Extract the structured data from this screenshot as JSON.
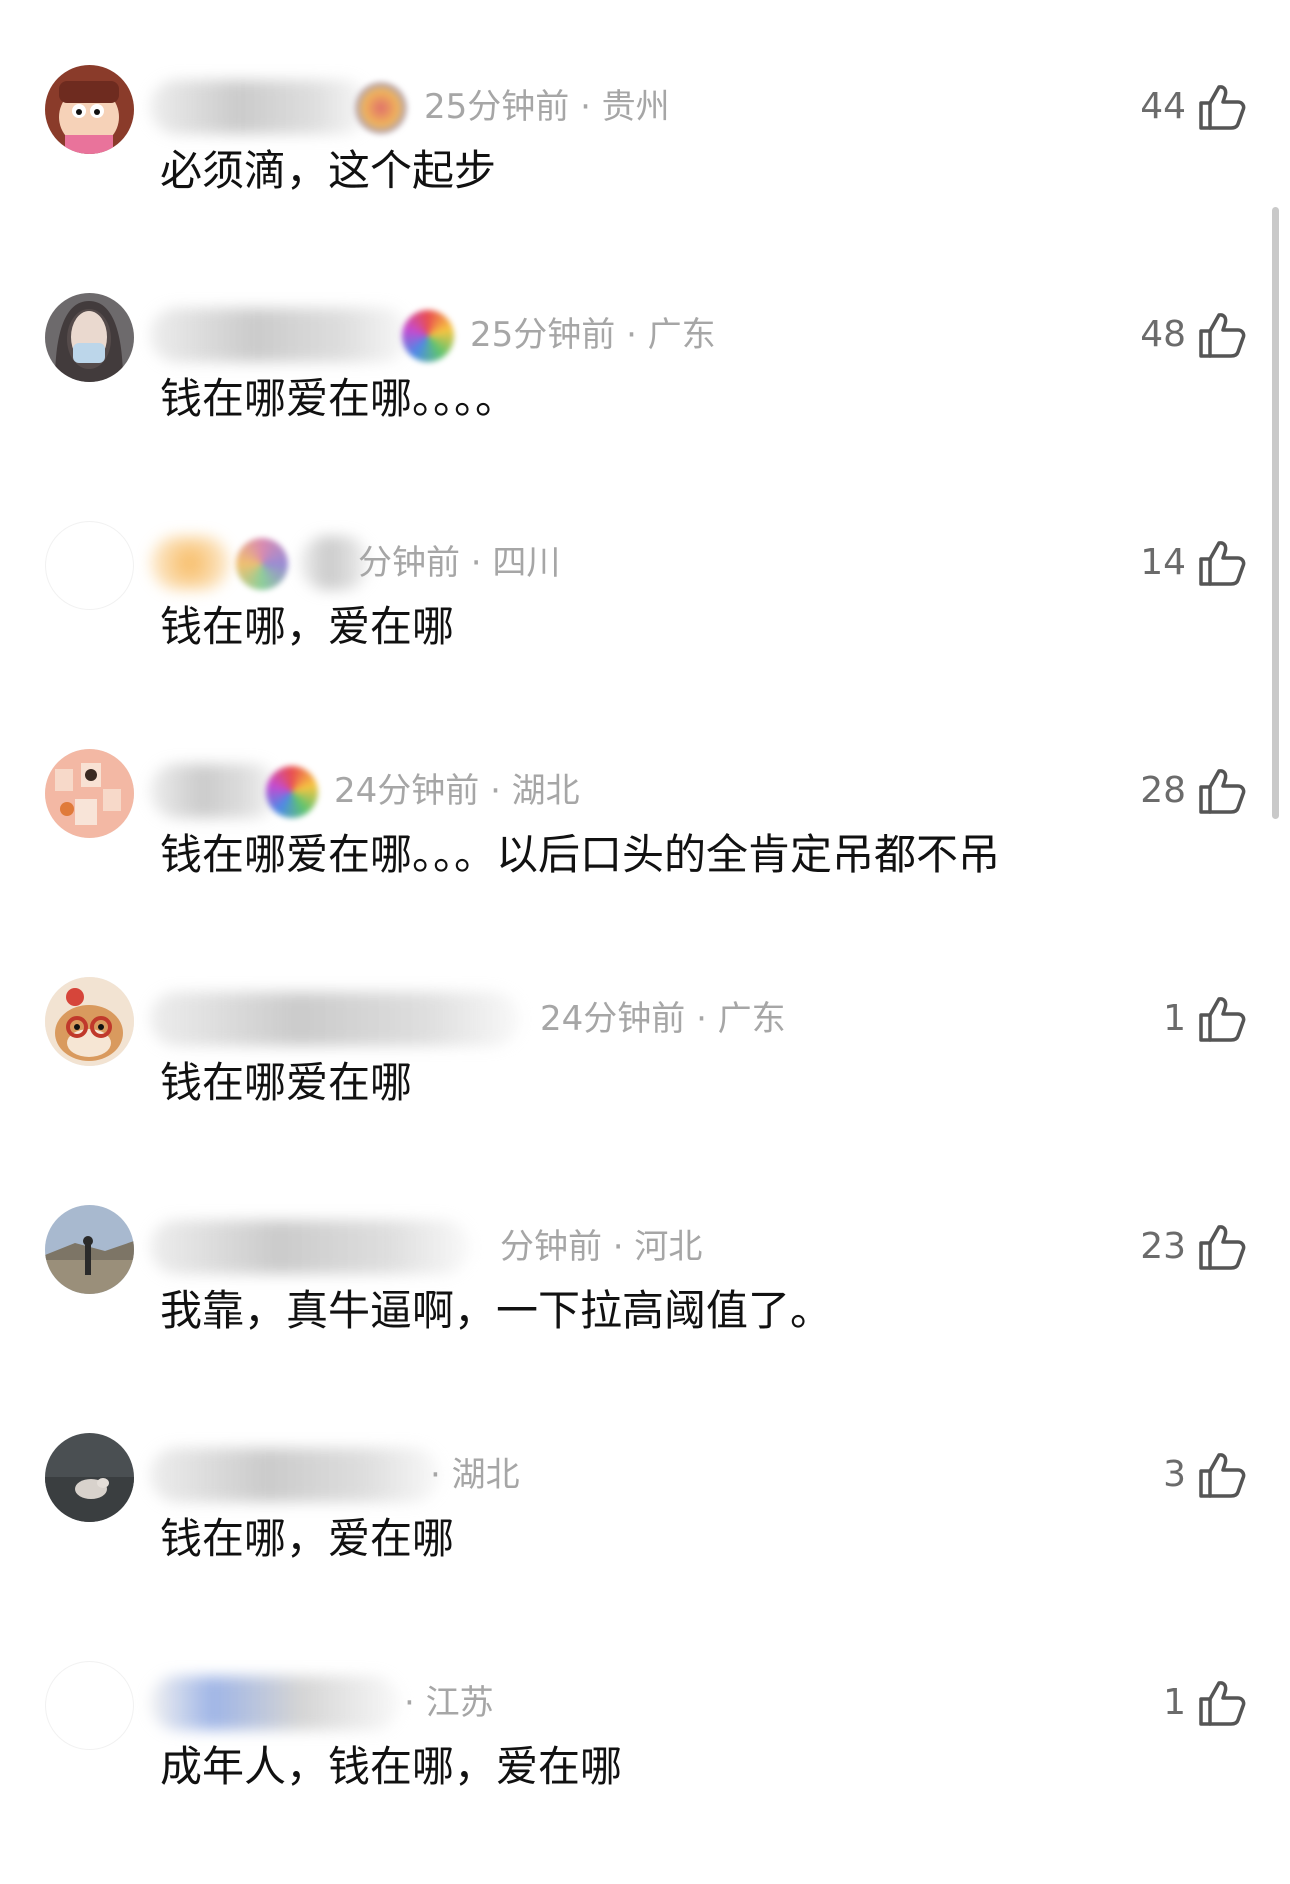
{
  "comments": [
    {
      "meta": "25分钟前 · 贵州",
      "text": "必须滴，这个起步",
      "likes": "44"
    },
    {
      "meta": "25分钟前 · 广东",
      "text": "钱在哪爱在哪。。。。",
      "likes": "48"
    },
    {
      "meta": "分钟前 · 四川",
      "text": "钱在哪，爱在哪",
      "likes": "14"
    },
    {
      "meta": "24分钟前 · 湖北",
      "text": "钱在哪爱在哪。。。以后口头的全肯定吊都不吊",
      "likes": "28"
    },
    {
      "meta": "24分钟前 · 广东",
      "text": "钱在哪爱在哪",
      "likes": "1"
    },
    {
      "meta": "分钟前 · 河北",
      "text": "我靠，真牛逼啊，一下拉高阈值了。",
      "likes": "23"
    },
    {
      "meta": "· 湖北",
      "text": "钱在哪，爱在哪",
      "likes": "3"
    },
    {
      "meta": "· 江苏",
      "text": "成年人，钱在哪，爱在哪",
      "likes": "1"
    }
  ],
  "icons": {
    "like": "thumbs-up-icon"
  },
  "colors": {
    "meta_text": "#a6a6a6",
    "comment_text": "#111111",
    "like_count": "#6b6b6b"
  }
}
